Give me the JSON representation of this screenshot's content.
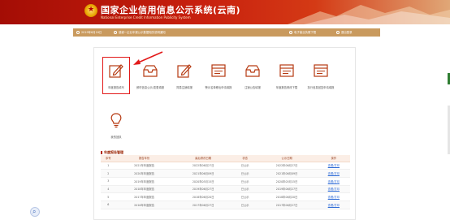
{
  "header": {
    "title": "国家企业信用信息公示系统(云南)",
    "subtitle": "National Enterprise Credit Information Publicity System",
    "brand_color": "#c8200e"
  },
  "infobar": {
    "date": "2019年6月18日",
    "notice": "感谢一企业年报公示数据相关说明通知",
    "right_link_1": "电子营业执照下载",
    "right_link_2": "退出登录"
  },
  "functions": [
    {
      "label": "年度报告填写",
      "icon": "edit-document-icon",
      "highlighted": true
    },
    {
      "label": "即时信息公示/变更填报",
      "icon": "inbox-icon"
    },
    {
      "label": "简易注销填报",
      "icon": "edit-document-icon"
    },
    {
      "label": "警示名单移出申请填报",
      "icon": "list-icon"
    },
    {
      "label": "注销公告填报",
      "icon": "inbox-icon"
    },
    {
      "label": "年度报告修改下载",
      "icon": "list-icon"
    },
    {
      "label": "执行信息回复申请填报",
      "icon": "list-icon"
    },
    {
      "label": "我的回执",
      "icon": "lightbulb-icon"
    }
  ],
  "section": {
    "title": "年度报告管理"
  },
  "table": {
    "headers": [
      "序号",
      "报告年份",
      "最后修改日期",
      "状态",
      "公示日期",
      "操作"
    ],
    "rows": [
      {
        "no": "1",
        "year": "2021年年度报告",
        "modified": "2022年06月27日",
        "status": "已公示",
        "published": "2022年06月27日",
        "action": "查看/打印"
      },
      {
        "no": "2",
        "year": "2020年年度报告",
        "modified": "2021年06月09日",
        "status": "已公示",
        "published": "2021年06月09日",
        "action": "查看/打印"
      },
      {
        "no": "3",
        "year": "2019年年度报告",
        "modified": "2020年05月15日",
        "status": "已公示",
        "published": "2020年05月15日",
        "action": "查看/打印"
      },
      {
        "no": "4",
        "year": "2018年年度报告",
        "modified": "2019年06月27日",
        "status": "已公示",
        "published": "2019年06月27日",
        "action": "查看/打印"
      },
      {
        "no": "5",
        "year": "2017年年度报告",
        "modified": "2018年06月20日",
        "status": "已公示",
        "published": "2018年06月20日",
        "action": "查看/打印"
      },
      {
        "no": "6",
        "year": "2016年年度报告",
        "modified": "2017年06月27日",
        "status": "已公示",
        "published": "2017年06月27日",
        "action": "查看/打印"
      }
    ]
  }
}
